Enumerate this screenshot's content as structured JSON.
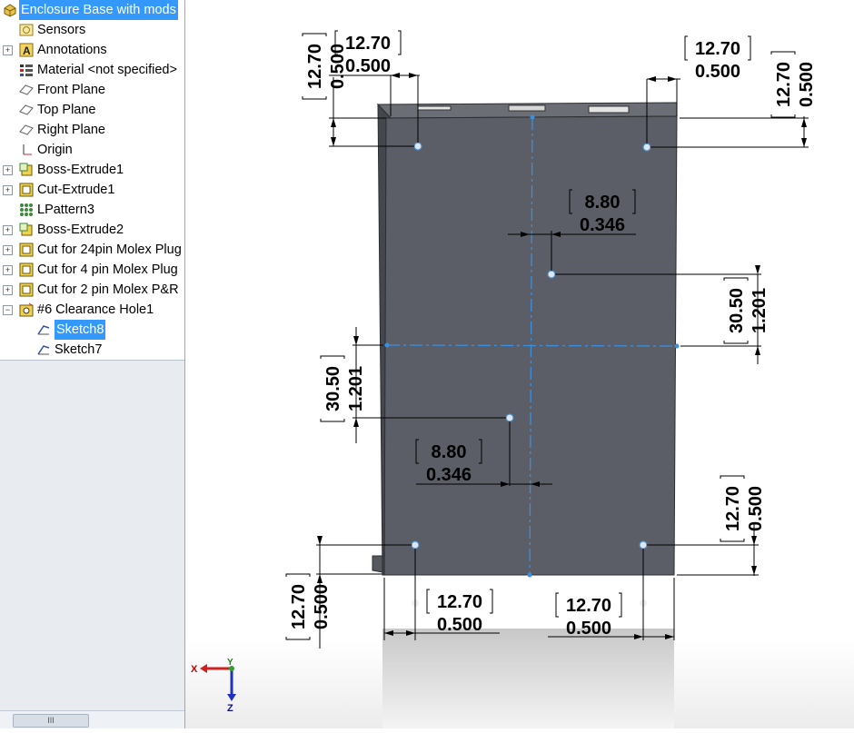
{
  "tree": {
    "root": "Enclosure Base with mods",
    "items": [
      {
        "label": "Sensors",
        "icon": "sensors-icon"
      },
      {
        "label": "Annotations",
        "icon": "annotations-icon",
        "expandable": true
      },
      {
        "label": "Material <not specified>",
        "icon": "material-icon"
      },
      {
        "label": "Front Plane",
        "icon": "plane-icon"
      },
      {
        "label": "Top Plane",
        "icon": "plane-icon"
      },
      {
        "label": "Right Plane",
        "icon": "plane-icon"
      },
      {
        "label": "Origin",
        "icon": "origin-icon"
      },
      {
        "label": "Boss-Extrude1",
        "icon": "boss-extrude-icon",
        "expandable": true
      },
      {
        "label": "Cut-Extrude1",
        "icon": "cut-extrude-icon",
        "expandable": true
      },
      {
        "label": "LPattern3",
        "icon": "linear-pattern-icon"
      },
      {
        "label": "Boss-Extrude2",
        "icon": "boss-extrude-icon",
        "expandable": true
      },
      {
        "label": "Cut for 24pin Molex Plug",
        "icon": "cut-extrude-icon",
        "expandable": true
      },
      {
        "label": "Cut for 4 pin Molex Plug",
        "icon": "cut-extrude-icon",
        "expandable": true
      },
      {
        "label": "Cut for 2 pin Molex P&R",
        "icon": "cut-extrude-icon",
        "expandable": true
      },
      {
        "label": "#6 Clearance Hole1",
        "icon": "hole-wizard-icon",
        "expandable": true,
        "expanded": true
      },
      {
        "label": "Sketch8",
        "icon": "sketch-icon",
        "selected": true
      },
      {
        "label": "Sketch7",
        "icon": "sketch-icon"
      }
    ]
  },
  "scrollbar": {
    "thumb_glyph": "III"
  },
  "splitter": {
    "glyph": "‹ ‹"
  },
  "triad": {
    "x_label": "X",
    "y_label": "Y",
    "z_label": "Z"
  },
  "dimensions": {
    "d1": {
      "mm": "12.70",
      "in": "0.500"
    },
    "d2": {
      "mm": "12.70",
      "in": "0.500"
    },
    "d3": {
      "mm": "12.70",
      "in": "0.500"
    },
    "d4": {
      "mm": "12.70",
      "in": "0.500"
    },
    "d5": {
      "mm": "8.80",
      "in": "0.346"
    },
    "d6": {
      "mm": "30.50",
      "in": "1.201"
    },
    "d7": {
      "mm": "30.50",
      "in": "1.201"
    },
    "d8": {
      "mm": "8.80",
      "in": "0.346"
    },
    "d9": {
      "mm": "12.70",
      "in": "0.500"
    },
    "d10": {
      "mm": "12.70",
      "in": "0.500"
    },
    "d11": {
      "mm": "12.70",
      "in": "0.500"
    },
    "d12": {
      "mm": "12.70",
      "in": "0.500"
    }
  },
  "colors": {
    "selection": "#3399ff",
    "part": "#5b5e66",
    "centerline": "#3b8fe0",
    "dimension": "#000000"
  }
}
